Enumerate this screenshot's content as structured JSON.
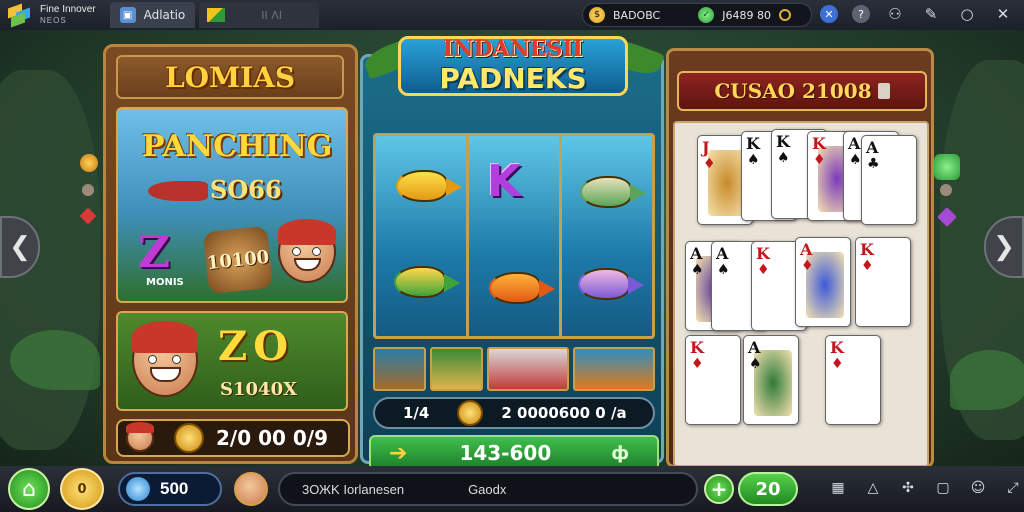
{
  "window": {
    "app_name_line1": "Fine Innover",
    "app_name_line2": "NEOS",
    "tab_title": "Adlatio",
    "tab2_text": "II ΛΙ",
    "stats_coins": "BADOBC",
    "stats_gems": "J6489 80",
    "controls": [
      "lock-icon",
      "help-icon",
      "users-icon",
      "edit-icon",
      "minimize-icon",
      "close-icon"
    ]
  },
  "left_panel": {
    "title": "LOMIAS",
    "headline": "PANCHING",
    "subline": "SO66",
    "z_bonus": "Z",
    "z_bonus_sub": "MONIS",
    "plaque_value": "10100",
    "bonus_big": "ZO",
    "bonus_amount": "S1040X",
    "bar_value": "2/0 00 0/9"
  },
  "center_panel": {
    "banner_top": "INDANESII",
    "banner_bottom": "PADNEKS",
    "reel_symbol": "K",
    "bar1_left": "1/4",
    "bar1_right": "2 0000600 0 /a",
    "bar2_value": "143-600",
    "bar2_icon": "ф"
  },
  "right_panel": {
    "title": "CUSAO 21008",
    "cards": [
      {
        "rank": "J",
        "suit": "♦",
        "color": "red"
      },
      {
        "rank": "K",
        "suit": "♠",
        "color": "black"
      },
      {
        "rank": "K",
        "suit": "♠",
        "color": "black"
      },
      {
        "rank": "K",
        "suit": "♦",
        "color": "red"
      },
      {
        "rank": "A",
        "suit": "♠",
        "color": "black"
      },
      {
        "rank": "A",
        "suit": "♣",
        "color": "black"
      },
      {
        "rank": "A",
        "suit": "♠",
        "color": "black"
      },
      {
        "rank": "A",
        "suit": "♠",
        "color": "black"
      },
      {
        "rank": "K",
        "suit": "♦",
        "color": "red"
      },
      {
        "rank": "A",
        "suit": "♦",
        "color": "red"
      },
      {
        "rank": "K",
        "suit": "♦",
        "color": "red"
      },
      {
        "rank": "K",
        "suit": "♦",
        "color": "red"
      },
      {
        "rank": "A",
        "suit": "♠",
        "color": "black"
      },
      {
        "rank": "K",
        "suit": "♦",
        "color": "red"
      }
    ]
  },
  "bottom_bar": {
    "coin_label": "0",
    "gem_value": "500",
    "message_left": "3ОЖK Iorlanesen",
    "message_right": "Gaodx",
    "plus_label": "+",
    "level_value": "20",
    "icons": [
      "grid-icon",
      "alert-icon",
      "puzzle-icon",
      "square-icon",
      "face-icon",
      "expand-icon"
    ]
  },
  "colors": {
    "accent_gold": "#ffd23f",
    "accent_green": "#3fbf4a",
    "wood": "#6b3c1f"
  }
}
